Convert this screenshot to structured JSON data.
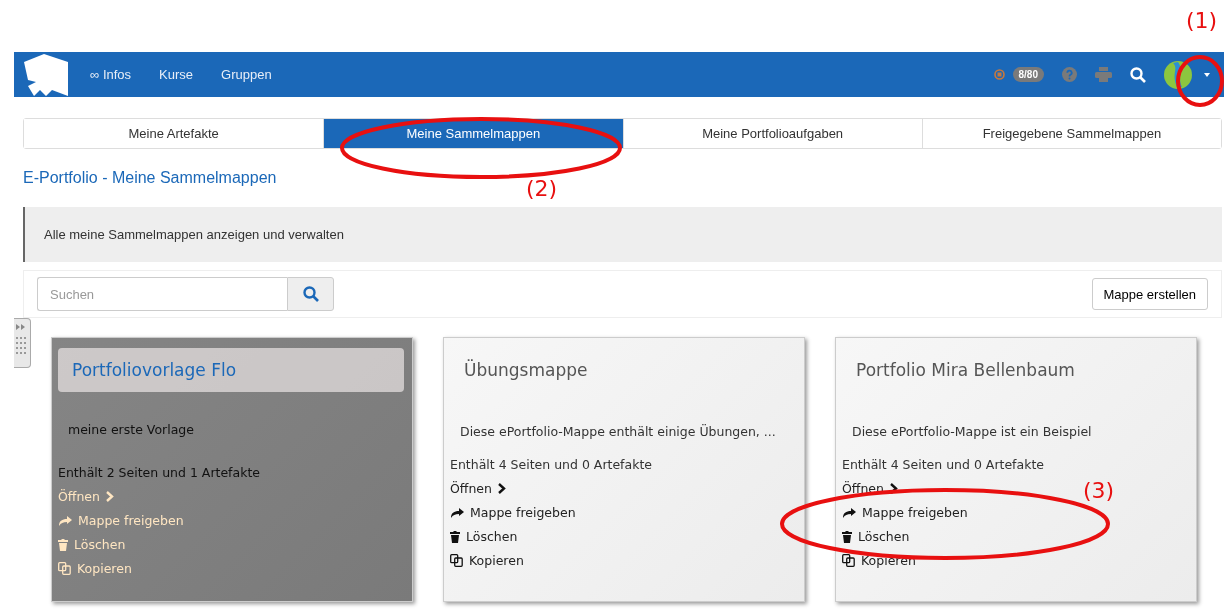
{
  "navbar": {
    "links": [
      {
        "label": "∞ Infos"
      },
      {
        "label": "Kurse"
      },
      {
        "label": "Gruppen"
      }
    ],
    "badge": "8/80"
  },
  "tabs": [
    {
      "label": "Meine Artefakte",
      "selected": false
    },
    {
      "label": "Meine Sammelmappen",
      "selected": true
    },
    {
      "label": "Meine Portfolioaufgaben",
      "selected": false
    },
    {
      "label": "Freigegebene Sammelmappen",
      "selected": false
    }
  ],
  "page_title": "E-Portfolio - Meine Sammelmappen",
  "info": "Alle meine Sammelmappen anzeigen und verwalten",
  "search": {
    "placeholder": "Suchen"
  },
  "create_button": "Mappe erstellen",
  "cards": [
    {
      "title": "Portfoliovorlage Flo",
      "description": "meine erste Vorlage",
      "summary": "Enthält 2 Seiten und 1 Artefakte",
      "selected": true,
      "actions": [
        {
          "kind": "open",
          "label": "Öffnen"
        },
        {
          "kind": "share",
          "label": "Mappe freigeben"
        },
        {
          "kind": "delete",
          "label": "Löschen"
        },
        {
          "kind": "copy",
          "label": "Kopieren"
        }
      ]
    },
    {
      "title": "Übungsmappe",
      "description": "Diese ePortfolio-Mappe enthält einige Übungen, ...",
      "summary": "Enthält 4 Seiten und 0 Artefakte",
      "selected": false,
      "actions": [
        {
          "kind": "open",
          "label": "Öffnen"
        },
        {
          "kind": "share",
          "label": "Mappe freigeben"
        },
        {
          "kind": "delete",
          "label": "Löschen"
        },
        {
          "kind": "copy",
          "label": "Kopieren"
        }
      ]
    },
    {
      "title": "Portfolio Mira Bellenbaum",
      "description": "Diese ePortfolio-Mappe ist ein Beispiel",
      "summary": "Enthält 4 Seiten und 0 Artefakte",
      "selected": false,
      "actions": [
        {
          "kind": "open",
          "label": "Öffnen"
        },
        {
          "kind": "share",
          "label": "Mappe freigeben"
        },
        {
          "kind": "delete",
          "label": "Löschen"
        },
        {
          "kind": "copy",
          "label": "Kopieren"
        }
      ]
    }
  ],
  "annotations": [
    {
      "label": "(1)"
    },
    {
      "label": "(2)"
    },
    {
      "label": "(3)"
    }
  ]
}
